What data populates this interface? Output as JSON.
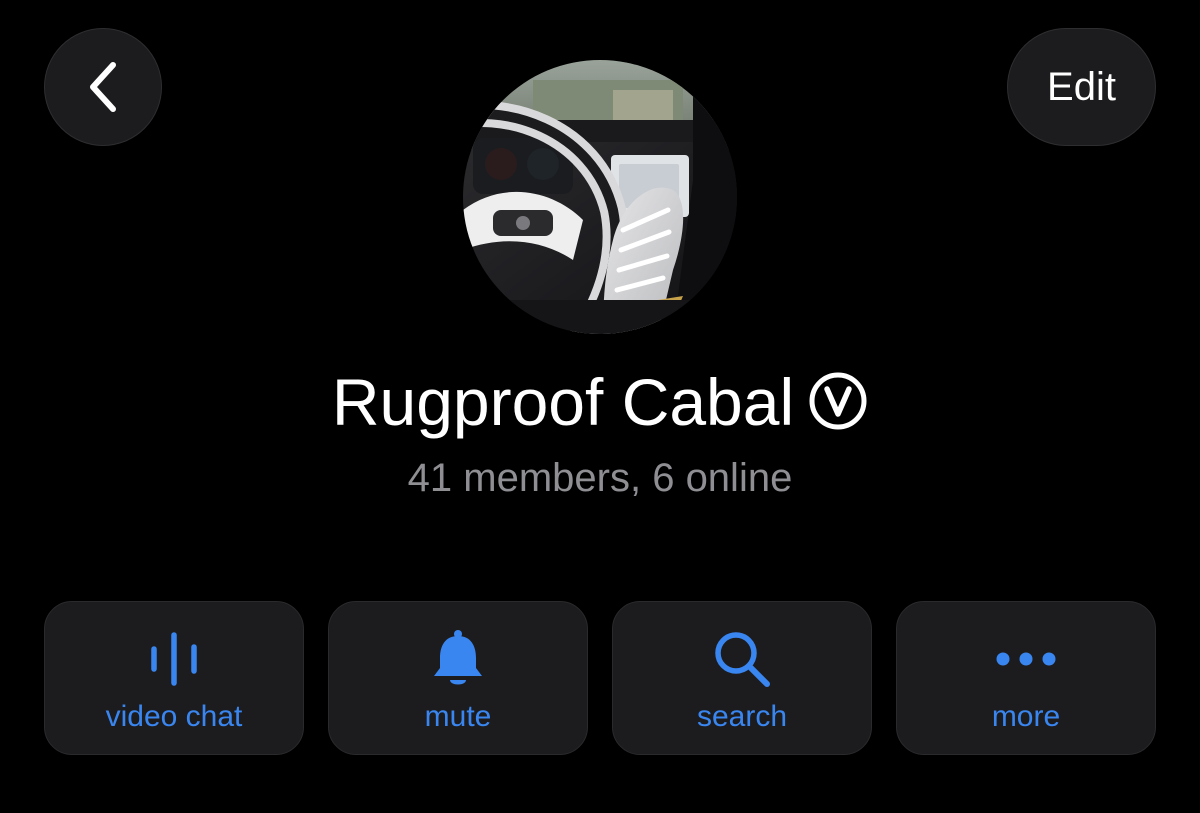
{
  "colors": {
    "background": "#000000",
    "surface": "#1c1c1e",
    "accent": "#3a86f0",
    "secondary_text": "#8e8e93"
  },
  "header": {
    "back_icon": "chevron-left-icon",
    "edit_label": "Edit"
  },
  "profile": {
    "avatar_description": "group-photo",
    "title": "Rugproof Cabal",
    "badge_icon": "verified-v-circle-icon",
    "subtitle": "41 members, 6 online"
  },
  "actions": [
    {
      "icon": "waveform-icon",
      "label": "video chat"
    },
    {
      "icon": "bell-icon",
      "label": "mute"
    },
    {
      "icon": "magnifier-icon",
      "label": "search"
    },
    {
      "icon": "ellipsis-icon",
      "label": "more"
    }
  ]
}
